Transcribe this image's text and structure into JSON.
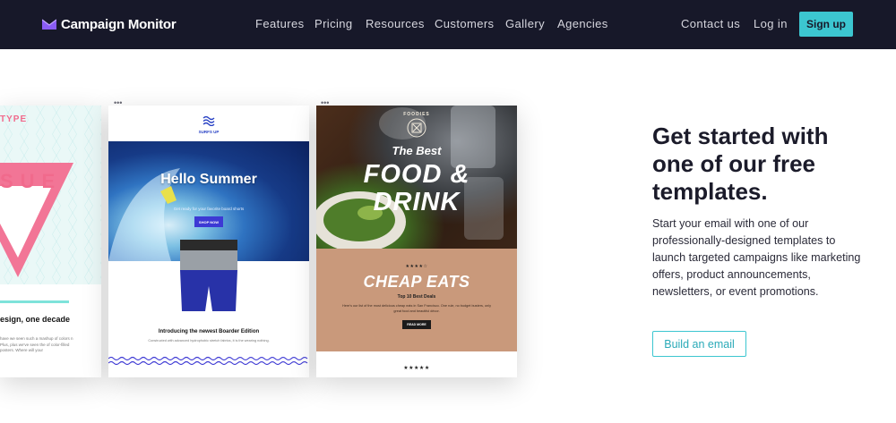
{
  "brand": {
    "name": "Campaign Monitor",
    "logo_icon": "envelope-chevron-icon",
    "logo_color": "#8a5cf5"
  },
  "nav": {
    "links": [
      "Features",
      "Pricing",
      "Resources",
      "Customers",
      "Gallery",
      "Agencies"
    ],
    "right_links": [
      "Contact us",
      "Log in"
    ],
    "signup": "Sign up",
    "background": "#171829",
    "accent": "#3cc6d0"
  },
  "templates": {
    "card1": {
      "type_label": "TYPE",
      "big": "SUE",
      "heading": "esign, one decade",
      "body": "have we seen such a mashup of colors n Plus, plus we've seen the of color-filled posters. Where will your"
    },
    "card2": {
      "brand": "SURFS UP",
      "hero_title": "Hello Summer",
      "hero_sub": "Get ready for your favorite board shorts",
      "button": "SHOP NOW",
      "title": "Introducing the newest Boarder Edition",
      "desc": "Constructed with advanced hydrophobic stretch fabrics, it is the wearing nothing."
    },
    "card3": {
      "badge": "FOODIES",
      "best": "The Best",
      "food": "FOOD & DRINK",
      "stars": "★★★★☆",
      "cheap": "CHEAP EATS",
      "deals": "Top 10 Best Deals",
      "copy": "Here's our list of the most delicious cheap eats in San Francisco. One rule, no budget busters, only great food and beautiful décor.",
      "button": "READ MORE",
      "bottom_stars": "★★★★★"
    }
  },
  "promo": {
    "headline": "Get started with one of our free templates.",
    "paragraph": "Start your email with one of our professionally-designed templates to launch targeted campaigns like marketing offers, product announcements, newsletters, or event promotions.",
    "cta": "Build an email"
  }
}
